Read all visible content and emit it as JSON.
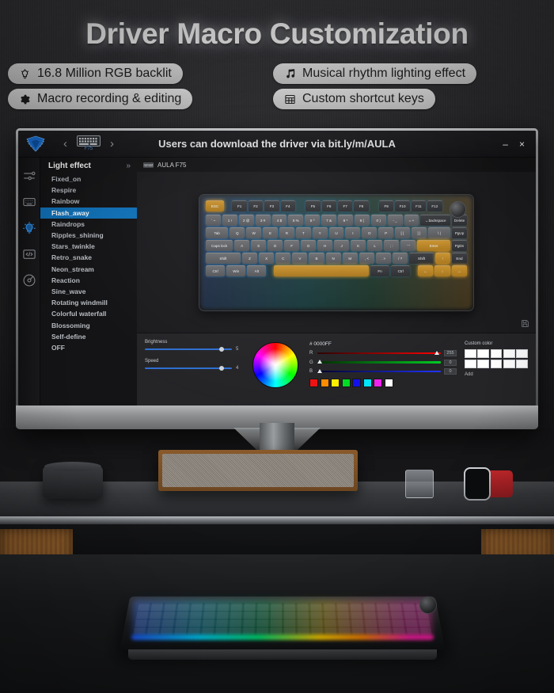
{
  "headline": "Driver Macro Customization",
  "features": [
    {
      "icon": "lightbulb-icon",
      "label": "16.8 Million RGB backlit"
    },
    {
      "icon": "gear-icon",
      "label": "Macro recording & editing"
    },
    {
      "icon": "music-note-icon",
      "label": "Musical rhythm lighting effect"
    },
    {
      "icon": "grid-table-icon",
      "label": "Custom shortcut keys"
    }
  ],
  "window": {
    "title": "Users can download the driver via bit.ly/m/AULA",
    "logo": "aula-eagle-logo",
    "device_thumb_label": "F75",
    "prev": "‹",
    "next": "›",
    "minimize": "–",
    "close": "×"
  },
  "rail": [
    {
      "name": "sliders-icon"
    },
    {
      "name": "keyboard-icon"
    },
    {
      "name": "lightbulb-icon"
    },
    {
      "name": "macro-code-icon"
    },
    {
      "name": "disc-icon"
    }
  ],
  "effects": {
    "title": "Light effect",
    "collapse": "»",
    "selected": "Flash_away",
    "items": [
      "Fixed_on",
      "Respire",
      "Rainbow",
      "Flash_away",
      "Raindrops",
      "Ripples_shining",
      "Stars_twinkle",
      "Retro_snake",
      "Neon_stream",
      "Reaction",
      "Sine_wave",
      "Rotating windmill",
      "Colorful waterfall",
      "Blossoming",
      "Self-define",
      "OFF"
    ]
  },
  "device": {
    "name": "AULA F75",
    "icon": "keyboard-icon"
  },
  "keyboard": {
    "save_icon": "save-disk-icon",
    "rows": [
      [
        {
          "label": "ESC",
          "style": "amber",
          "w": 1.25
        },
        {
          "label": "",
          "style": "gap",
          "w": 0.35
        },
        {
          "label": "F1",
          "style": "dark",
          "w": 1
        },
        {
          "label": "F2",
          "style": "dark",
          "w": 1
        },
        {
          "label": "F3",
          "style": "dark",
          "w": 1
        },
        {
          "label": "F4",
          "style": "dark",
          "w": 1
        },
        {
          "label": "",
          "style": "gap",
          "w": 0.5
        },
        {
          "label": "F5",
          "style": "dark",
          "w": 1
        },
        {
          "label": "F6",
          "style": "dark",
          "w": 1
        },
        {
          "label": "F7",
          "style": "dark",
          "w": 1
        },
        {
          "label": "F8",
          "style": "dark",
          "w": 1
        },
        {
          "label": "",
          "style": "gap",
          "w": 0.5
        },
        {
          "label": "F9",
          "style": "dark",
          "w": 1
        },
        {
          "label": "F10",
          "style": "dark",
          "w": 1
        },
        {
          "label": "F11",
          "style": "dark",
          "w": 1
        },
        {
          "label": "F12",
          "style": "dark",
          "w": 1
        },
        {
          "label": "",
          "style": "gap",
          "w": 1.6
        }
      ],
      [
        {
          "label": "` ~",
          "w": 1
        },
        {
          "label": "1 !",
          "w": 1
        },
        {
          "label": "2 @",
          "w": 1
        },
        {
          "label": "3 #",
          "w": 1
        },
        {
          "label": "4 $",
          "w": 1
        },
        {
          "label": "5 %",
          "w": 1
        },
        {
          "label": "6 ^",
          "w": 1
        },
        {
          "label": "7 &",
          "w": 1
        },
        {
          "label": "8 *",
          "w": 1
        },
        {
          "label": "9 (",
          "w": 1
        },
        {
          "label": "0 )",
          "w": 1
        },
        {
          "label": "- _",
          "w": 1
        },
        {
          "label": "= +",
          "w": 1
        },
        {
          "label": "←backspace",
          "style": "dark",
          "w": 2
        },
        {
          "label": "Delete",
          "style": "dark",
          "w": 1
        }
      ],
      [
        {
          "label": "Tab",
          "w": 1.5
        },
        {
          "label": "Q",
          "w": 1
        },
        {
          "label": "W",
          "w": 1
        },
        {
          "label": "E",
          "w": 1
        },
        {
          "label": "R",
          "w": 1
        },
        {
          "label": "T",
          "w": 1
        },
        {
          "label": "Y",
          "w": 1
        },
        {
          "label": "U",
          "w": 1
        },
        {
          "label": "I",
          "w": 1
        },
        {
          "label": "O",
          "w": 1
        },
        {
          "label": "P",
          "w": 1
        },
        {
          "label": "[ {",
          "w": 1
        },
        {
          "label": "] }",
          "w": 1
        },
        {
          "label": "\\ |",
          "w": 1.5
        },
        {
          "label": "PgUp",
          "style": "dark",
          "w": 1
        }
      ],
      [
        {
          "label": "Caps lock",
          "w": 1.8
        },
        {
          "label": "A",
          "w": 1
        },
        {
          "label": "S",
          "w": 1
        },
        {
          "label": "D",
          "w": 1
        },
        {
          "label": "F",
          "w": 1
        },
        {
          "label": "G",
          "w": 1
        },
        {
          "label": "H",
          "w": 1
        },
        {
          "label": "J",
          "w": 1
        },
        {
          "label": "K",
          "w": 1
        },
        {
          "label": "L",
          "w": 1
        },
        {
          "label": "; :",
          "w": 1
        },
        {
          "label": "' \"",
          "w": 1
        },
        {
          "label": "Enter",
          "style": "amber",
          "w": 2.2
        },
        {
          "label": "PgDn",
          "style": "dark",
          "w": 1
        }
      ],
      [
        {
          "label": "Shift",
          "w": 2.3
        },
        {
          "label": "Z",
          "w": 1
        },
        {
          "label": "X",
          "w": 1
        },
        {
          "label": "C",
          "w": 1
        },
        {
          "label": "V",
          "w": 1
        },
        {
          "label": "B",
          "w": 1
        },
        {
          "label": "N",
          "w": 1
        },
        {
          "label": "M",
          "w": 1
        },
        {
          "label": ", <",
          "w": 1
        },
        {
          "label": ". >",
          "w": 1
        },
        {
          "label": "/ ?",
          "w": 1
        },
        {
          "label": "Shift",
          "style": "dark",
          "w": 1.6
        },
        {
          "label": "↑",
          "style": "amber",
          "w": 1
        },
        {
          "label": "End",
          "style": "dark",
          "w": 1
        }
      ],
      [
        {
          "label": "Ctrl",
          "w": 1.25
        },
        {
          "label": "Win",
          "w": 1.25
        },
        {
          "label": "Alt",
          "w": 1.25
        },
        {
          "label": "",
          "style": "gap",
          "w": 0.3
        },
        {
          "label": "",
          "style": "amber",
          "w": 6.2
        },
        {
          "label": "Fn",
          "style": "dark",
          "w": 1.25
        },
        {
          "label": "Ctrl",
          "style": "dark",
          "w": 1.25
        },
        {
          "label": "",
          "style": "gap",
          "w": 0.3
        },
        {
          "label": "←",
          "style": "amber",
          "w": 1
        },
        {
          "label": "↓",
          "style": "amber",
          "w": 1
        },
        {
          "label": "→",
          "style": "amber",
          "w": 1
        }
      ]
    ]
  },
  "controls": {
    "brightness": {
      "label": "Brightness",
      "value": "5",
      "percent": 88
    },
    "speed": {
      "label": "Speed",
      "value": "4",
      "percent": 88
    },
    "color_wheel": "color-wheel",
    "hex": "# 0000FF",
    "channels": [
      {
        "name": "R",
        "value": "255",
        "percent": 97
      },
      {
        "name": "G",
        "value": "0",
        "percent": 2
      },
      {
        "name": "B",
        "value": "0",
        "percent": 2
      }
    ],
    "swatches": [
      "#ee1111",
      "#ff8c00",
      "#ffee00",
      "#00dd22",
      "#1111ee",
      "#00e5ff",
      "#ee22ee",
      "#ffffff"
    ],
    "custom_color": {
      "title": "Custom color",
      "cells": 10,
      "add": "Add"
    }
  },
  "colors": {
    "accent_blue": "#1071b8",
    "amber_key": "#c9922e",
    "panel_bg": "#252528",
    "window_bg": "#141416"
  }
}
